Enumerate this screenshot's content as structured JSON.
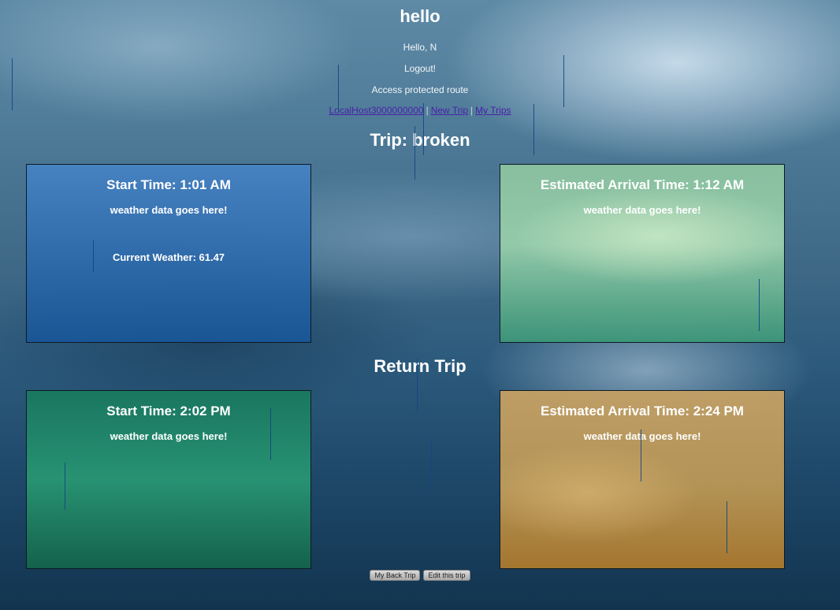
{
  "header": {
    "title": "hello",
    "greeting": "Hello, N",
    "logout_label": "Logout!",
    "protected_label": "Access protected route"
  },
  "nav": {
    "links": [
      "LocalHost3000000000",
      "New Trip",
      "My Trips"
    ],
    "separator": "|"
  },
  "trip": {
    "title": "Trip: broken",
    "outbound": {
      "start": {
        "time_label": "Start Time: 1:01 AM",
        "weather_label": "weather data goes here!",
        "current_weather": "Current Weather: 61.47"
      },
      "arrival": {
        "time_label": "Estimated Arrival Time: 1:12 AM",
        "weather_label": "weather data goes here!"
      }
    },
    "return_title": "Return Trip",
    "return": {
      "start": {
        "time_label": "Start Time: 2:02 PM",
        "weather_label": "weather data goes here!"
      },
      "arrival": {
        "time_label": "Estimated Arrival Time: 2:24 PM",
        "weather_label": "weather data goes here!"
      }
    }
  },
  "buttons": {
    "back_trip": "My Back Trip",
    "edit_trip": "Edit this trip"
  },
  "colors": {
    "link": "#4a1fa8",
    "text": "#ffffff"
  }
}
